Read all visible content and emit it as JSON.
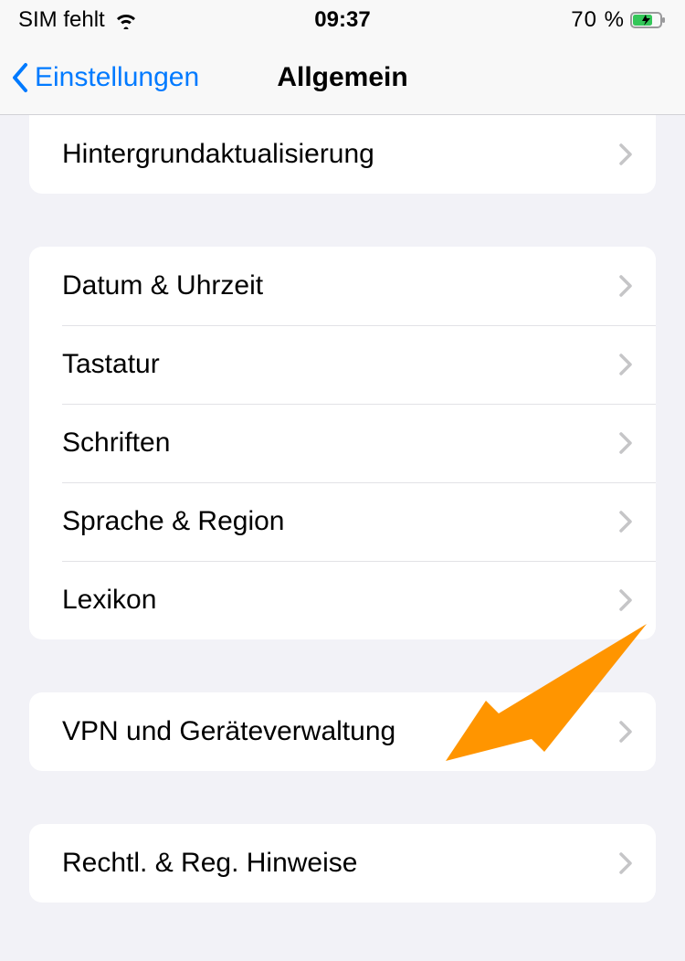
{
  "status_bar": {
    "sim_text": "SIM fehlt",
    "time": "09:37",
    "battery_text": "70 %"
  },
  "nav": {
    "back_label": "Einstellungen",
    "title": "Allgemein"
  },
  "sections": [
    {
      "rows": [
        {
          "label": "Hintergrundaktualisierung",
          "name": "row-background-app-refresh"
        }
      ],
      "partialTop": true
    },
    {
      "rows": [
        {
          "label": "Datum & Uhrzeit",
          "name": "row-date-time"
        },
        {
          "label": "Tastatur",
          "name": "row-keyboard"
        },
        {
          "label": "Schriften",
          "name": "row-fonts"
        },
        {
          "label": "Sprache & Region",
          "name": "row-language-region"
        },
        {
          "label": "Lexikon",
          "name": "row-dictionary"
        }
      ]
    },
    {
      "rows": [
        {
          "label": "VPN und Geräteverwaltung",
          "name": "row-vpn-device-management"
        }
      ]
    },
    {
      "rows": [
        {
          "label": "Rechtl. & Reg. Hinweise",
          "name": "row-legal-regulatory"
        }
      ]
    }
  ]
}
